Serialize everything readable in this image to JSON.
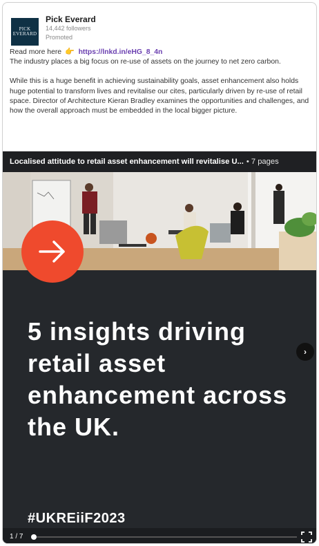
{
  "post": {
    "author": "Pick Everard",
    "logo_text": [
      "PICK",
      "EVERARD"
    ],
    "followers": "14,442 followers",
    "promoted": "Promoted",
    "read_more": "Read more here",
    "link": "https://lnkd.in/eHG_8_4n",
    "paragraph1": "The industry places a big focus on re-use of assets on the journey to net zero carbon.",
    "paragraph2": "While this is a huge benefit in achieving sustainability goals, asset enhancement also holds huge potential to transform lives and revitalise our cites, particularly driven by re-use of retail space. Director of Architecture Kieran Bradley examines the opportunities and challenges, and how the overall approach must be embedded in the local bigger picture."
  },
  "document": {
    "title": "Localised attitude to retail asset enhancement will revitalise U...",
    "pages_label": "• 7 pages",
    "headline": "5 insights driving retail asset enhancement across the UK.",
    "hashtag": "#UKREiiF2023",
    "page_indicator": "1 / 7",
    "progress": 0.0
  },
  "icons": {
    "pointing": "pointing-hand-icon",
    "arrow": "arrow-right-icon",
    "next": "chevron-right-icon",
    "fullscreen": "fullscreen-icon"
  },
  "colors": {
    "brand_navy": "#0f3145",
    "accent_orange": "#ef4a2d",
    "link_purple": "#6a3fb0",
    "slide_bg": "#25282c"
  }
}
